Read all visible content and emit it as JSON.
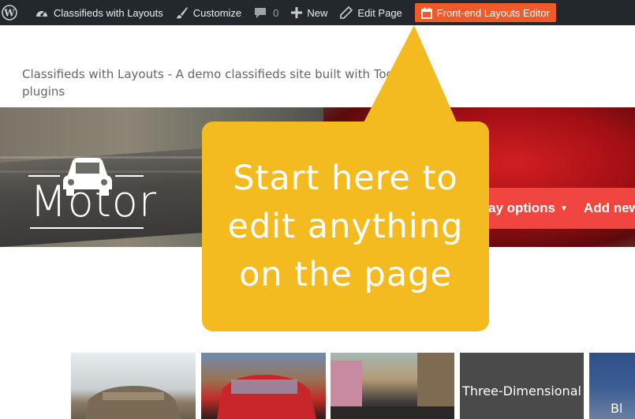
{
  "admin_bar": {
    "site_name": "Classifieds with Layouts",
    "customize": "Customize",
    "comments_count": "0",
    "new": "New",
    "edit_page": "Edit Page",
    "layouts_editor": "Front-end Layouts Editor",
    "bg_color": "#23282d",
    "accent_color": "#f05a28"
  },
  "header": {
    "tagline": "Classifieds with Layouts - A demo classifieds site built with Too plugins"
  },
  "hero": {
    "brand": "Motor",
    "display_options": "ay options",
    "add_new": "Add new",
    "button_color": "#f0463f"
  },
  "callout": {
    "text": "Start here to edit anything on the page",
    "color": "#f3bb20"
  },
  "thumbnails": [
    {
      "label": ""
    },
    {
      "label": ""
    },
    {
      "label": ""
    },
    {
      "label": "Three-Dimensional"
    },
    {
      "label": "Bl"
    }
  ]
}
